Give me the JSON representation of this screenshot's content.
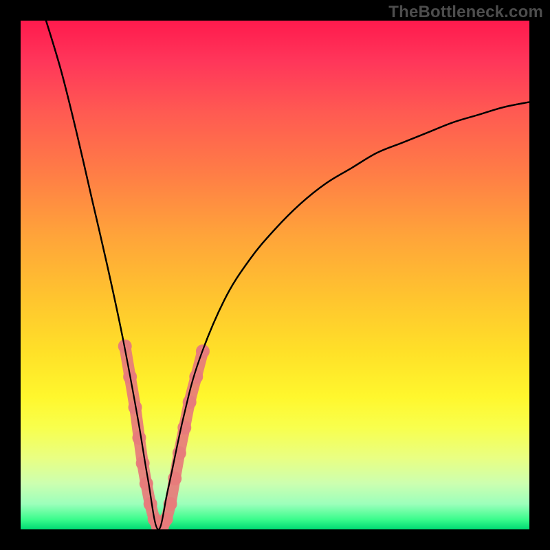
{
  "watermark": "TheBottleneck.com",
  "chart_data": {
    "type": "line",
    "title": "",
    "xlabel": "",
    "ylabel": "",
    "xlim": [
      0,
      100
    ],
    "ylim": [
      0,
      100
    ],
    "background_gradient": {
      "top_color": "#ff1a4d",
      "mid_color": "#ffe028",
      "bottom_color": "#00d973",
      "meaning": "red=worse, green=better (bottleneck gradient)"
    },
    "series": [
      {
        "name": "bottleneck-curve",
        "description": "V-shaped curve, minimum around x≈27 at y≈0",
        "x": [
          5,
          8,
          11,
          14,
          17,
          20,
          23,
          25,
          27,
          29,
          32,
          35,
          40,
          45,
          50,
          55,
          60,
          65,
          70,
          75,
          80,
          85,
          90,
          95,
          100
        ],
        "y": [
          100,
          90,
          78,
          65,
          52,
          38,
          22,
          10,
          0,
          8,
          22,
          33,
          45,
          53,
          59,
          64,
          68,
          71,
          74,
          76,
          78,
          80,
          81.5,
          83,
          84
        ]
      }
    ],
    "markers": {
      "name": "highlighted-range",
      "color": "#e77b7b",
      "description": "thick salmon markers clustered around the curve minimum",
      "points": [
        {
          "x": 20.5,
          "y": 36
        },
        {
          "x": 21.5,
          "y": 30
        },
        {
          "x": 22.5,
          "y": 24
        },
        {
          "x": 23.3,
          "y": 18
        },
        {
          "x": 24.0,
          "y": 13
        },
        {
          "x": 24.7,
          "y": 9
        },
        {
          "x": 25.5,
          "y": 5
        },
        {
          "x": 26.3,
          "y": 2
        },
        {
          "x": 27.0,
          "y": 0.5
        },
        {
          "x": 27.8,
          "y": 0.5
        },
        {
          "x": 28.6,
          "y": 2
        },
        {
          "x": 29.4,
          "y": 5
        },
        {
          "x": 30.3,
          "y": 10
        },
        {
          "x": 31.2,
          "y": 15
        },
        {
          "x": 32.2,
          "y": 20
        },
        {
          "x": 33.2,
          "y": 25
        },
        {
          "x": 34.5,
          "y": 30
        },
        {
          "x": 35.8,
          "y": 35
        }
      ]
    }
  }
}
